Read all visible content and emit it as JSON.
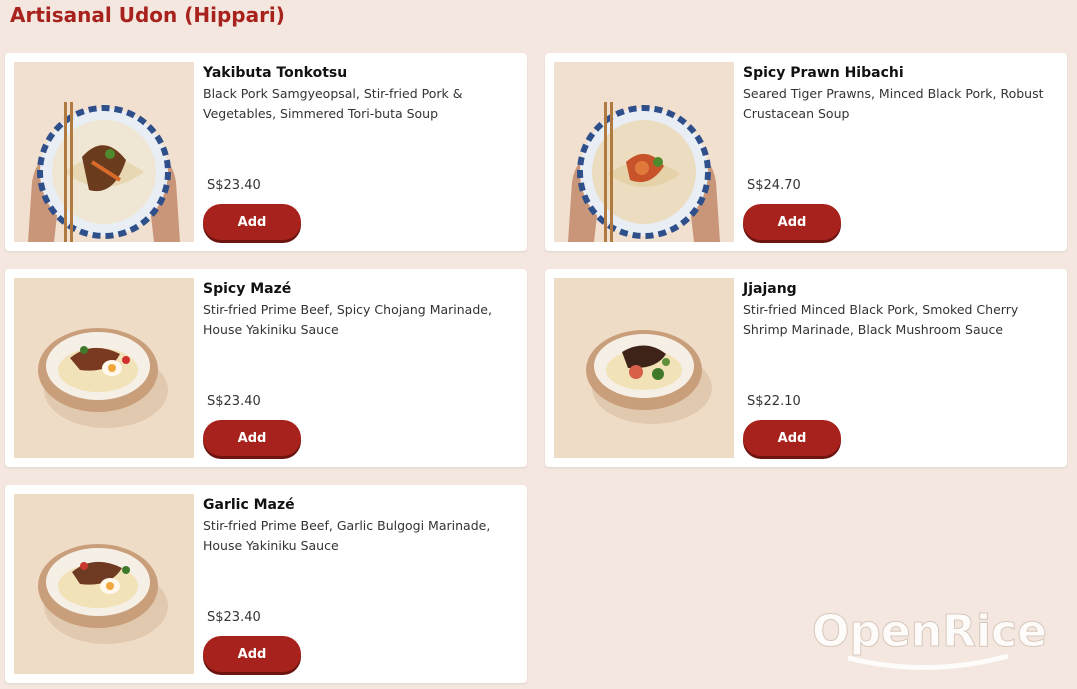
{
  "section": {
    "title": "Artisanal Udon (Hippari)"
  },
  "items": [
    {
      "name": "Yakibuta Tonkotsu",
      "description": "Black Pork Samgyeopsal, Stir-fried Pork & Vegetables, Simmered Tori-buta Soup",
      "price": "S$23.40",
      "add_label": "Add",
      "image": "udon-bowl-hands-icon"
    },
    {
      "name": "Spicy Prawn Hibachi",
      "description": "Seared Tiger Prawns, Minced Black Pork, Robust Crustacean Soup",
      "price": "S$24.70",
      "add_label": "Add",
      "image": "udon-bowl-hands-icon"
    },
    {
      "name": "Spicy Mazé",
      "description": "Stir-fried Prime Beef, Spicy Chojang Marinade, House Yakiniku Sauce",
      "price": "S$23.40",
      "add_label": "Add",
      "image": "maze-bowl-icon"
    },
    {
      "name": "Jjajang",
      "description": "Stir-fried Minced Black Pork, Smoked Cherry Shrimp Marinade, Black Mushroom Sauce",
      "price": "S$22.10",
      "add_label": "Add",
      "image": "maze-bowl-icon"
    },
    {
      "name": "Garlic Mazé",
      "description": "Stir-fried Prime Beef, Garlic Bulgogi Marinade, House Yakiniku Sauce",
      "price": "S$23.40",
      "add_label": "Add",
      "image": "maze-bowl-icon"
    }
  ],
  "watermark": {
    "text": "OpenRice"
  },
  "colors": {
    "accent": "#a8221d",
    "background": "#f3e7df",
    "card": "#ffffff"
  }
}
